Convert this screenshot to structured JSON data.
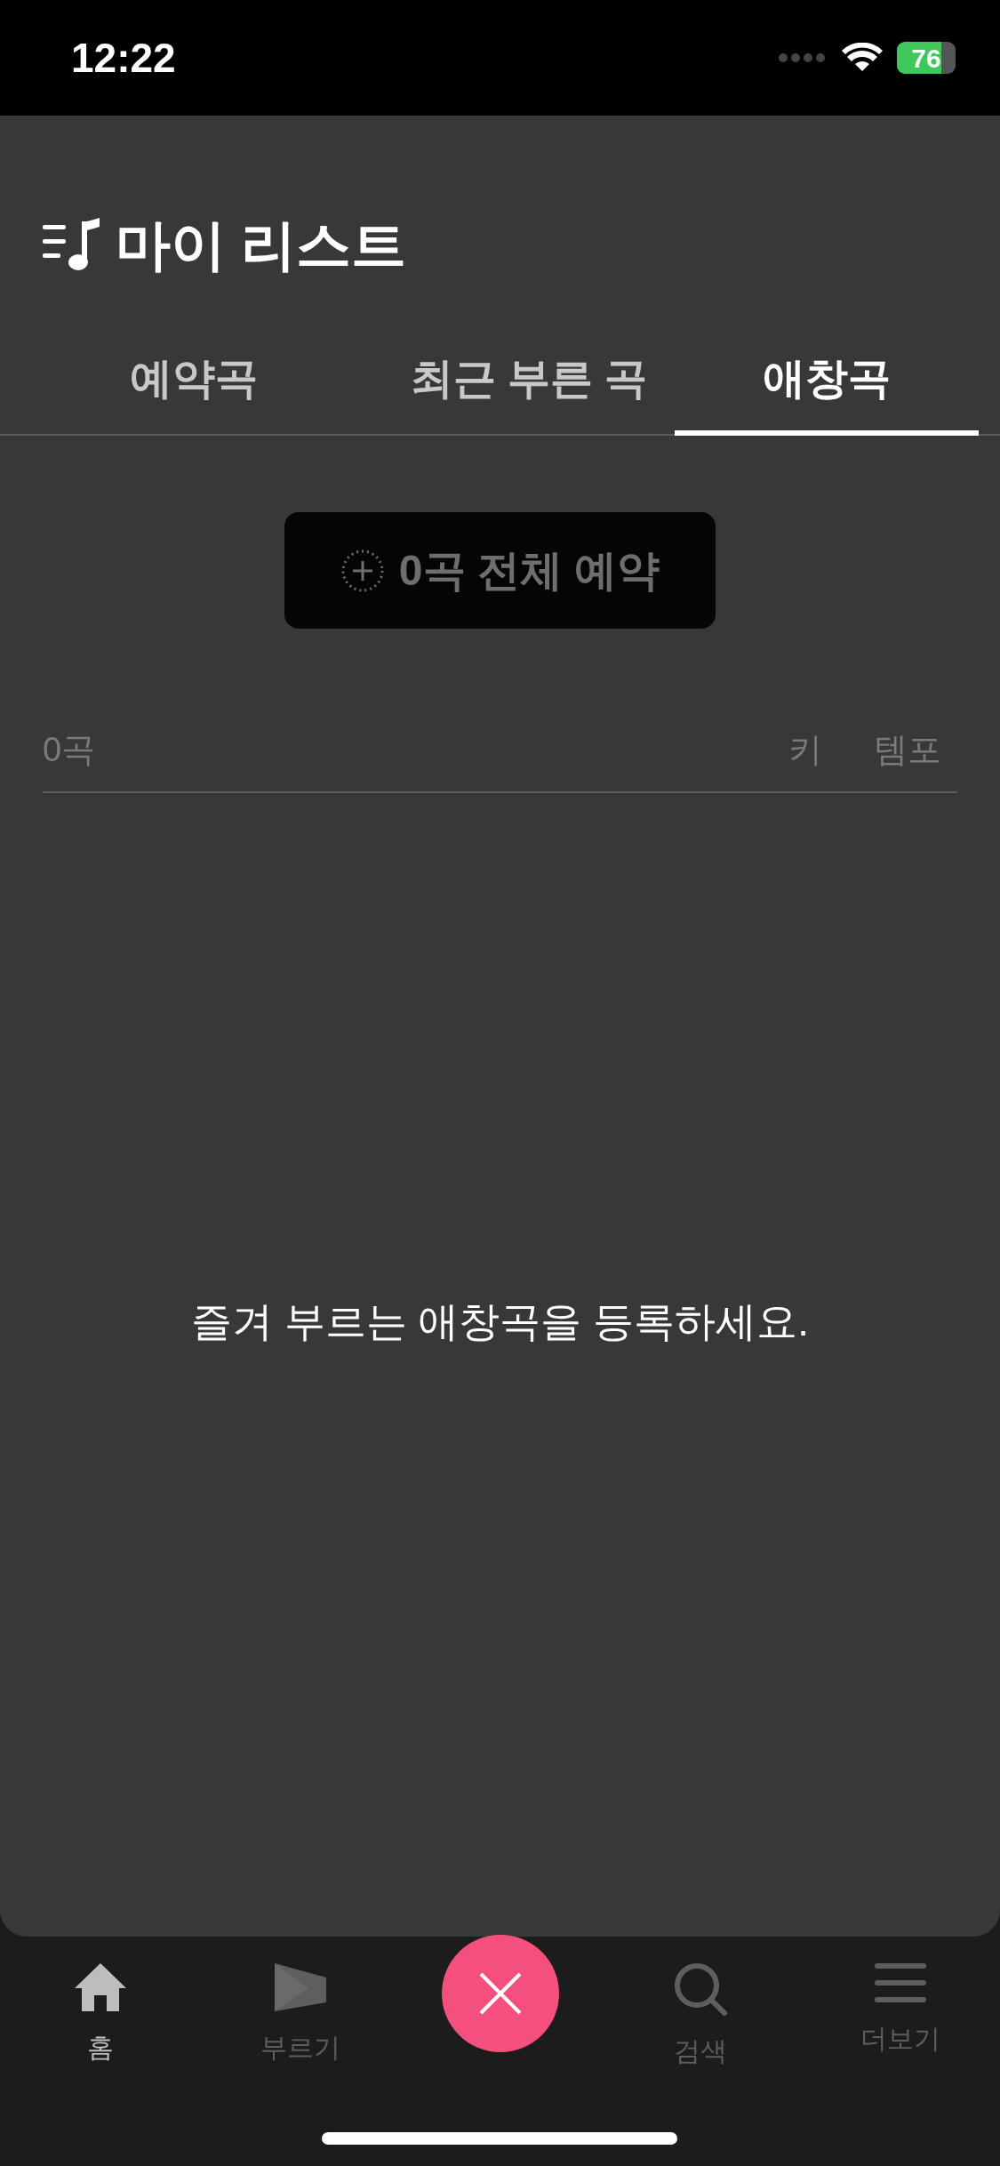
{
  "status_bar": {
    "time": "12:22",
    "battery": "76"
  },
  "header": {
    "title": "마이 리스트"
  },
  "tabs": [
    {
      "label": "예약곡",
      "selected": false
    },
    {
      "label": "최근 부른 곡",
      "selected": false
    },
    {
      "label": "애창곡",
      "selected": true
    }
  ],
  "reserve_all_button": {
    "label": "0곡 전체 예약",
    "disabled": true
  },
  "list_header": {
    "count": "0곡",
    "columns": [
      "키",
      "템포"
    ]
  },
  "empty_message": "즐겨 부르는 애창곡을 등록하세요.",
  "bottom_nav": [
    {
      "kind": "home",
      "label": "홈",
      "selected": true
    },
    {
      "kind": "sing",
      "label": "부르기",
      "selected": false
    },
    {
      "kind": "fab"
    },
    {
      "kind": "search",
      "label": "검색",
      "selected": false
    },
    {
      "kind": "more",
      "label": "더보기",
      "selected": false
    }
  ]
}
